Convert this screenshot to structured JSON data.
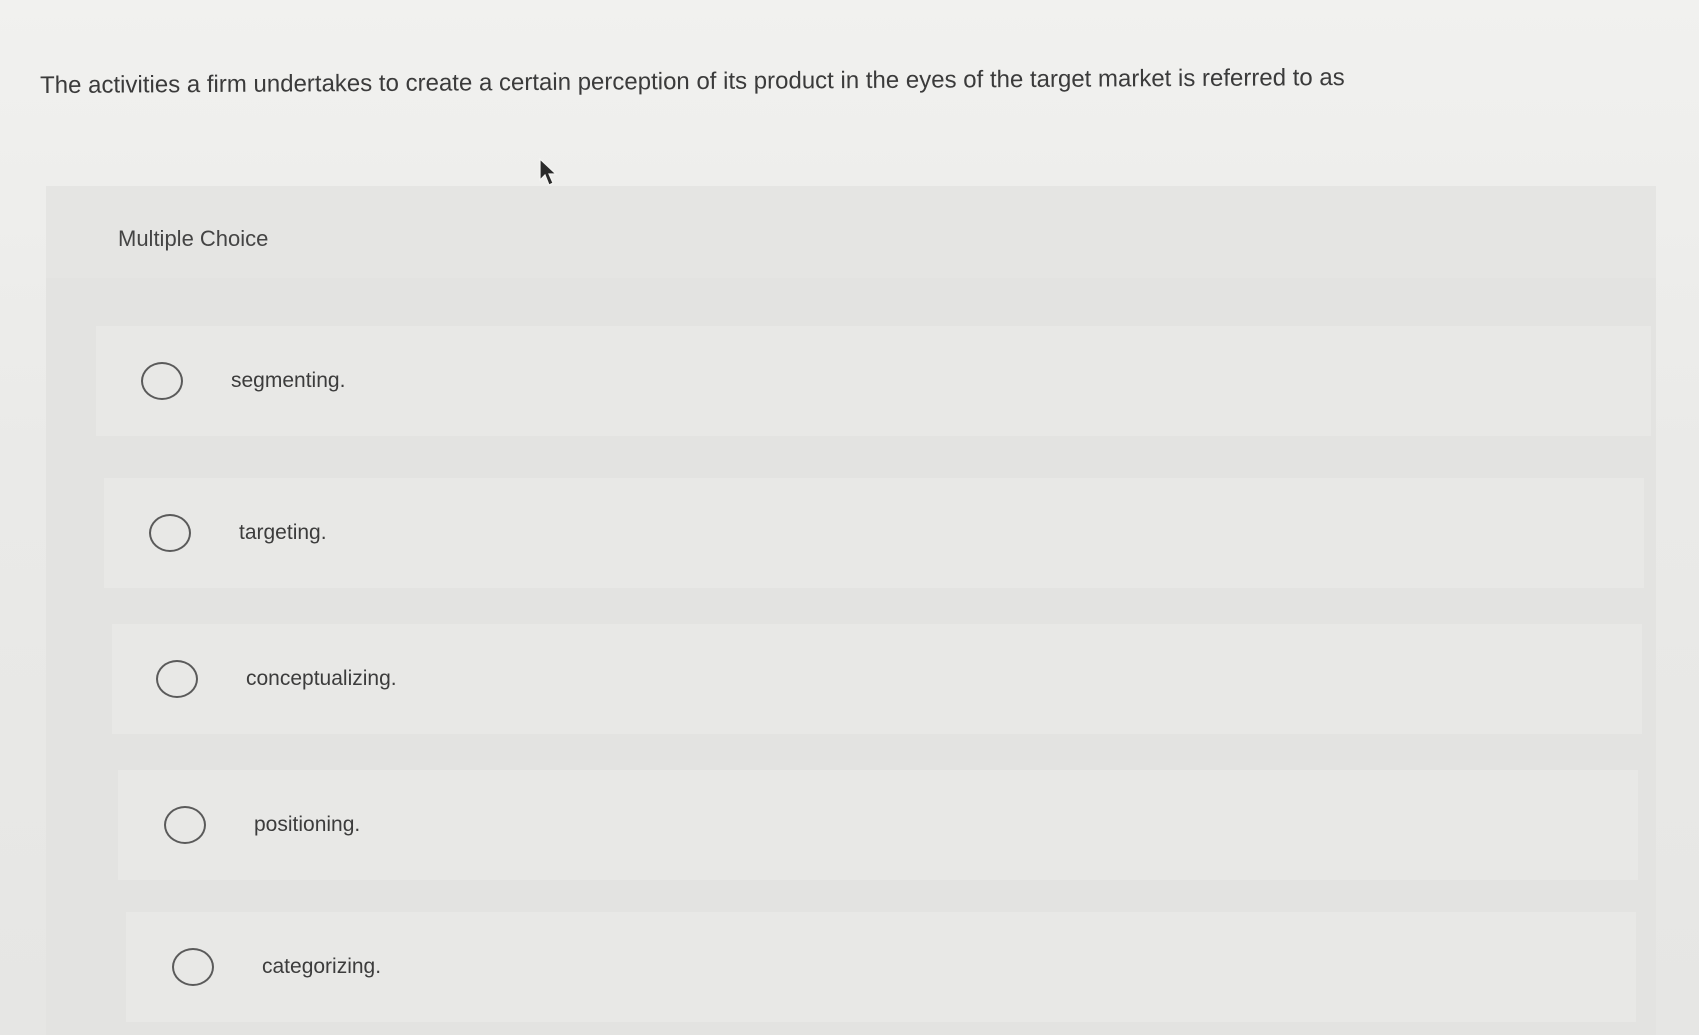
{
  "question": {
    "text": "The activities a firm undertakes to create a certain perception of its product in the eyes of the target market is referred to as"
  },
  "card": {
    "label": "Multiple Choice"
  },
  "options": [
    {
      "label": "segmenting."
    },
    {
      "label": "targeting."
    },
    {
      "label": "conceptualizing."
    },
    {
      "label": "positioning."
    },
    {
      "label": "categorizing."
    }
  ],
  "cursor": {
    "icon": "arrow-cursor-icon"
  }
}
